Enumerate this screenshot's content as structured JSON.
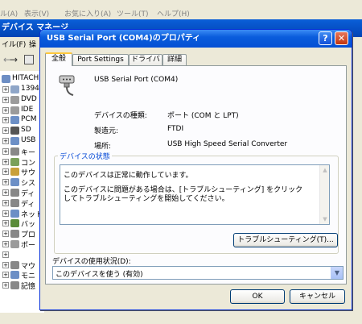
{
  "background_window": {
    "faded_menu": [
      "ル(A)",
      "表示(V)",
      "お気に入り(A)",
      "ツール(T)",
      "ヘルプ(H)"
    ],
    "title": "デバイス マネージ",
    "menu": [
      "イル(F)",
      "操"
    ],
    "tree_root": "HITACH",
    "tree_items": [
      "1394",
      "DVD",
      "IDE",
      "PCM",
      "SD ",
      "USB",
      "キー",
      "コン",
      "サウ",
      "シス",
      "ディ",
      "ディ",
      "ネット",
      "バッ",
      "プロ",
      "ポー",
      "",
      "マウ",
      "モニ",
      "記憶"
    ]
  },
  "dialog": {
    "title": "USB Serial Port (COM4)のプロパティ",
    "help_glyph": "?",
    "close_glyph": "✕",
    "tabs": [
      "全般",
      "Port Settings",
      "ドライバ",
      "詳細"
    ],
    "device_name": "USB Serial Port (COM4)",
    "properties": {
      "type_label": "デバイスの種類:",
      "type_value": "ポート (COM と LPT)",
      "maker_label": "製造元:",
      "maker_value": "FTDI",
      "location_label": "場所:",
      "location_value": "USB High Speed Serial Converter"
    },
    "status_group_label": "デバイスの状態",
    "status_line1": "このデバイスは正常に動作しています。",
    "status_line2": "このデバイスに問題がある場合は、[トラブルシューティング] をクリックしてトラブルシューティングを開始してください。",
    "troubleshoot_button": "トラブルシューティング(T)...",
    "usage_label": "デバイスの使用状況(D):",
    "usage_value": "このデバイスを使う (有効)",
    "ok_button": "OK",
    "cancel_button": "キャンセル"
  }
}
